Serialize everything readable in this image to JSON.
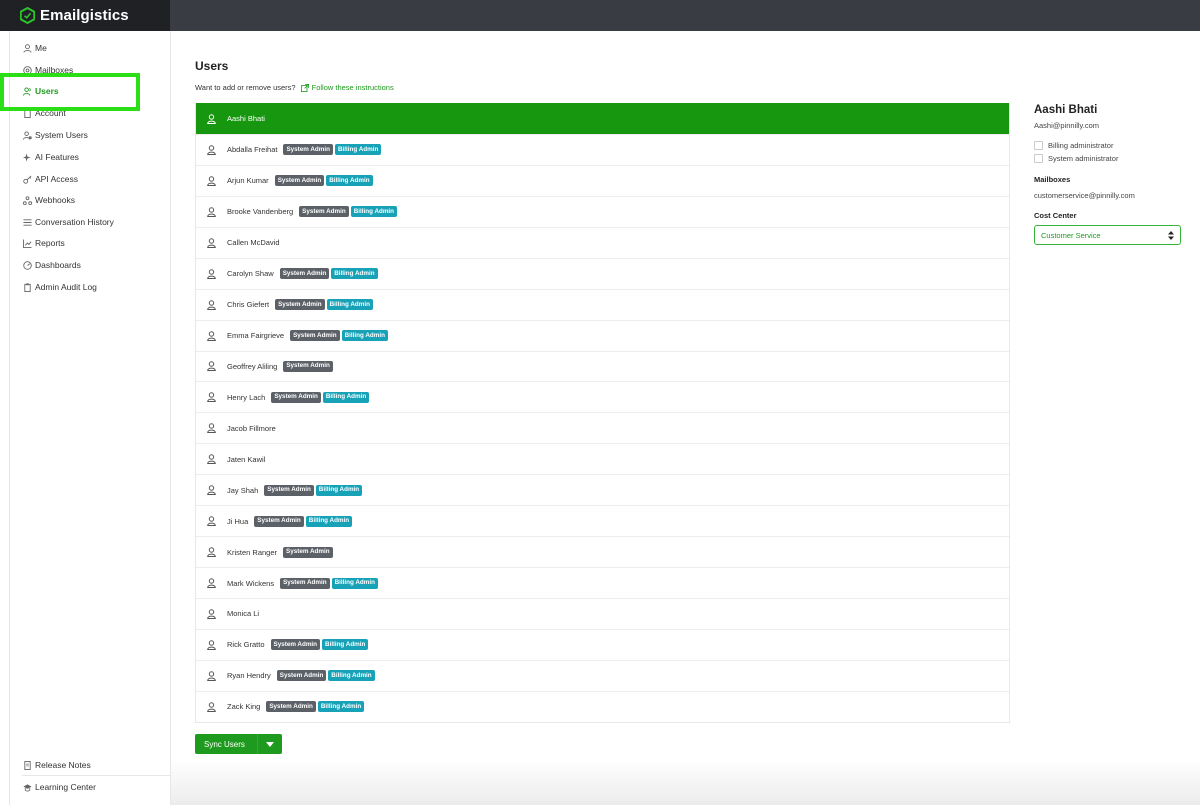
{
  "app": {
    "name": "Emailgistics",
    "brand_color": "#1e9a1e"
  },
  "sidebar": {
    "items": [
      {
        "label": "Me",
        "icon": "user-icon"
      },
      {
        "label": "Mailboxes",
        "icon": "at-icon"
      },
      {
        "label": "Users",
        "icon": "users-icon",
        "active": true
      },
      {
        "label": "Account",
        "icon": "building-icon"
      },
      {
        "label": "System Users",
        "icon": "system-users-icon"
      },
      {
        "label": "AI Features",
        "icon": "sparkle-icon"
      },
      {
        "label": "API Access",
        "icon": "key-icon"
      },
      {
        "label": "Webhooks",
        "icon": "webhook-icon"
      },
      {
        "label": "Conversation History",
        "icon": "list-icon"
      },
      {
        "label": "Reports",
        "icon": "chart-icon"
      },
      {
        "label": "Dashboards",
        "icon": "gauge-icon"
      },
      {
        "label": "Admin Audit Log",
        "icon": "clipboard-icon"
      }
    ],
    "footer": [
      {
        "label": "Release Notes",
        "icon": "document-icon"
      },
      {
        "label": "Learning Center",
        "icon": "graduation-icon"
      }
    ]
  },
  "main": {
    "title": "Users",
    "hint_text": "Want to add or remove users?",
    "hint_link": "Follow these instructions",
    "badge_labels": {
      "system": "System Admin",
      "billing": "Billing Admin"
    },
    "users": [
      {
        "name": "Aashi Bhati",
        "system": false,
        "billing": false,
        "selected": true
      },
      {
        "name": "Abdalla Freihat",
        "system": true,
        "billing": true
      },
      {
        "name": "Arjun Kumar",
        "system": true,
        "billing": true
      },
      {
        "name": "Brooke Vandenberg",
        "system": true,
        "billing": true
      },
      {
        "name": "Callen McDavid",
        "system": false,
        "billing": false
      },
      {
        "name": "Carolyn Shaw",
        "system": true,
        "billing": true
      },
      {
        "name": "Chris Giefert",
        "system": true,
        "billing": true
      },
      {
        "name": "Emma Fairgrieve",
        "system": true,
        "billing": true
      },
      {
        "name": "Geoffrey Aliling",
        "system": true,
        "billing": false
      },
      {
        "name": "Henry Lach",
        "system": true,
        "billing": true
      },
      {
        "name": "Jacob Fillmore",
        "system": false,
        "billing": false
      },
      {
        "name": "Jaten Kawil",
        "system": false,
        "billing": false
      },
      {
        "name": "Jay Shah",
        "system": true,
        "billing": true
      },
      {
        "name": "Ji Hua",
        "system": true,
        "billing": true
      },
      {
        "name": "Kristen Ranger",
        "system": true,
        "billing": false
      },
      {
        "name": "Mark Wickens",
        "system": true,
        "billing": true
      },
      {
        "name": "Monica Li",
        "system": false,
        "billing": false
      },
      {
        "name": "Rick Gratto",
        "system": true,
        "billing": true
      },
      {
        "name": "Ryan Hendry",
        "system": true,
        "billing": true
      },
      {
        "name": "Zack King",
        "system": true,
        "billing": true
      }
    ],
    "sync_button": "Sync Users"
  },
  "details": {
    "name": "Aashi Bhati",
    "email": "Aashi@pinnilly.com",
    "billing_label": "Billing administrator",
    "billing_checked": false,
    "system_label": "System administrator",
    "system_checked": false,
    "mailboxes_label": "Mailboxes",
    "mailbox": "customerservice@pinnilly.com",
    "cost_center_label": "Cost Center",
    "cost_center_value": "Customer Service"
  }
}
